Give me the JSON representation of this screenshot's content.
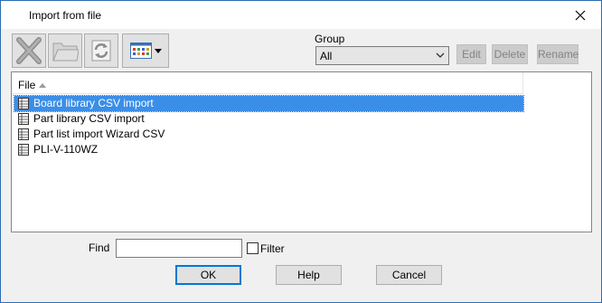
{
  "window": {
    "title": "Import from file",
    "close_glyph": "✕"
  },
  "toolbar": {
    "buttons": [
      {
        "name": "delete-tool",
        "icon": "cross-icon"
      },
      {
        "name": "open-folder-tool",
        "icon": "folder-icon"
      },
      {
        "name": "refresh-tool",
        "icon": "refresh-icon"
      },
      {
        "name": "view-mode-tool",
        "icon": "grid-view-icon"
      }
    ]
  },
  "group": {
    "label": "Group",
    "selected": "All",
    "edit_label": "Edit",
    "delete_label": "Delete",
    "rename_label": "Rename"
  },
  "list": {
    "column_header": "File",
    "items": [
      {
        "label": "Board library CSV import",
        "selected": true
      },
      {
        "label": "Part library CSV import",
        "selected": false
      },
      {
        "label": "Part list import Wizard CSV",
        "selected": false
      },
      {
        "label": "PLI-V-110WZ",
        "selected": false
      }
    ]
  },
  "find": {
    "label": "Find",
    "value": "",
    "filter_label": "Filter",
    "filter_checked": false
  },
  "buttons": {
    "ok_label": "OK",
    "help_label": "Help",
    "cancel_label": "Cancel"
  },
  "colors": {
    "accent": "#0078d7",
    "selection": "#3b8ee8",
    "frame": "#2b6cb3"
  }
}
